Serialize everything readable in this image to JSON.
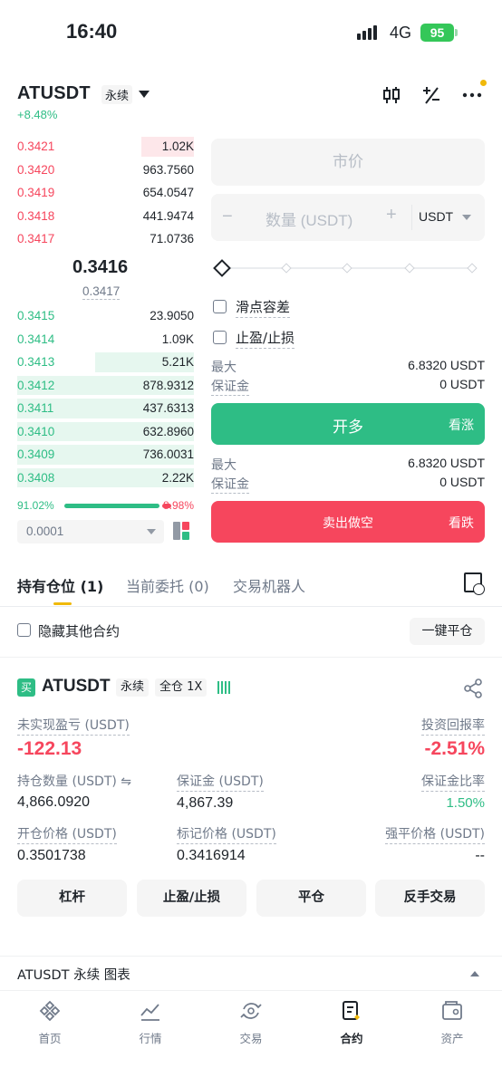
{
  "status": {
    "time": "16:40",
    "network": "4G",
    "battery": "95"
  },
  "header": {
    "symbol": "ATUSDT",
    "contract_type": "永续",
    "change": "+8.48%"
  },
  "orderbook": {
    "asks": [
      {
        "price": "0.3421",
        "qty": "1.02K",
        "depth": 0.3
      },
      {
        "price": "0.3420",
        "qty": "963.7560",
        "depth": 0
      },
      {
        "price": "0.3419",
        "qty": "654.0547",
        "depth": 0
      },
      {
        "price": "0.3418",
        "qty": "441.9474",
        "depth": 0
      },
      {
        "price": "0.3417",
        "qty": "71.0736",
        "depth": 0
      }
    ],
    "last_price": "0.3416",
    "mark_price": "0.3417",
    "bids": [
      {
        "price": "0.3415",
        "qty": "23.9050",
        "depth": 0
      },
      {
        "price": "0.3414",
        "qty": "1.09K",
        "depth": 0
      },
      {
        "price": "0.3413",
        "qty": "5.21K",
        "depth": 0.56
      },
      {
        "price": "0.3412",
        "qty": "878.9312",
        "depth": 1.0
      },
      {
        "price": "0.3411",
        "qty": "437.6313",
        "depth": 1.0
      },
      {
        "price": "0.3410",
        "qty": "632.8960",
        "depth": 1.0
      },
      {
        "price": "0.3409",
        "qty": "736.0031",
        "depth": 1.0
      },
      {
        "price": "0.3408",
        "qty": "2.22K",
        "depth": 1.0
      }
    ],
    "buy_ratio": "91.02%",
    "sell_ratio": "8.98%",
    "precision": "0.0001"
  },
  "order_form": {
    "order_type": "市价",
    "qty_placeholder": "数量 (USDT)",
    "qty_minus": "−",
    "qty_plus": "+",
    "qty_unit": "USDT",
    "slippage_label": "滑点容差",
    "tpsl_label": "止盈/止损",
    "long": {
      "max_label": "最大",
      "max_value": "6.8320 USDT",
      "margin_label": "保证金",
      "margin_value": "0 USDT",
      "button": "开多",
      "hint": "看涨"
    },
    "short": {
      "max_label": "最大",
      "max_value": "6.8320 USDT",
      "margin_label": "保证金",
      "margin_value": "0 USDT",
      "button": "卖出做空",
      "hint": "看跌"
    }
  },
  "tabs": {
    "positions": "持有仓位 (1)",
    "open_orders": "当前委托 (0)",
    "bots": "交易机器人"
  },
  "positions_panel": {
    "hide_other": "隐藏其他合约",
    "close_all": "一键平仓"
  },
  "position": {
    "side_badge": "买",
    "symbol": "ATUSDT",
    "contract_type": "永续",
    "margin_mode": "全仓 1X",
    "upnl_label": "未实现盈亏 (USDT)",
    "upnl_value": "-122.13",
    "roi_label": "投资回报率",
    "roi_value": "-2.51%",
    "size_label": "持仓数量 (USDT) ⇋",
    "size_value": "4,866.0920",
    "margin_label": "保证金 (USDT)",
    "margin_value": "4,867.39",
    "margin_ratio_label": "保证金比率",
    "margin_ratio_value": "1.50%",
    "entry_label": "开仓价格 (USDT)",
    "entry_value": "0.3501738",
    "mark_label": "标记价格 (USDT)",
    "mark_value": "0.3416914",
    "liq_label": "强平价格 (USDT)",
    "liq_value": "--",
    "buttons": [
      "杠杆",
      "止盈/止损",
      "平仓",
      "反手交易"
    ]
  },
  "chart_row": {
    "label": "ATUSDT 永续  图表"
  },
  "nav": [
    "首页",
    "行情",
    "交易",
    "合约",
    "资产"
  ],
  "colors": {
    "green": "#2ebd85",
    "red": "#f6465d",
    "accent": "#f0b90b"
  }
}
